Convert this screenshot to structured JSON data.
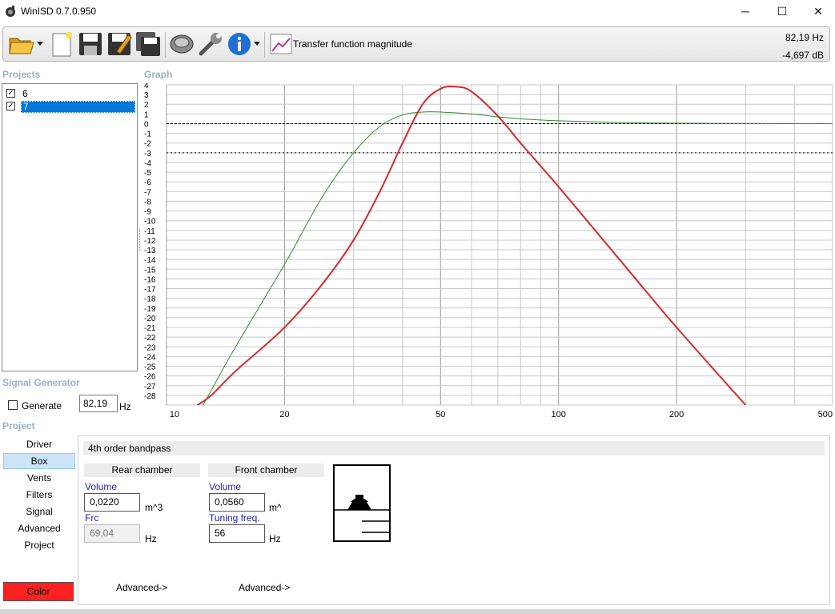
{
  "window": {
    "title": "WinISD 0.7.0.950",
    "controls": {
      "minimize": "─",
      "maximize": "☐",
      "close": "✕"
    }
  },
  "toolbar": {
    "icons": [
      "open-folder-icon",
      "new-file-icon",
      "save-icon",
      "save-as-icon",
      "save-all-icon",
      "driver-icon",
      "tools-icon",
      "info-icon",
      "graph-icon"
    ],
    "graph_type_label": "Transfer function magnitude",
    "readout": {
      "frequency": "82,19 Hz",
      "level": "-4,697 dB"
    }
  },
  "projects": {
    "title": "Projects",
    "items": [
      {
        "label": "6",
        "checked": true,
        "selected": false
      },
      {
        "label": "7",
        "checked": true,
        "selected": true
      }
    ]
  },
  "graph": {
    "title": "Graph"
  },
  "chart_data": {
    "type": "line",
    "title": "",
    "xlabel": "",
    "ylabel": "",
    "x_scale": "log",
    "xlim": [
      10,
      500
    ],
    "ylim": [
      -29,
      4
    ],
    "x_ticks": [
      10,
      20,
      50,
      100,
      200,
      500
    ],
    "y_ticks": [
      4,
      3,
      2,
      1,
      0,
      -1,
      -2,
      -3,
      -4,
      -5,
      -6,
      -7,
      -8,
      -9,
      -10,
      -11,
      -12,
      -13,
      -14,
      -15,
      -16,
      -17,
      -18,
      -19,
      -20,
      -21,
      -22,
      -23,
      -24,
      -25,
      -26,
      -27,
      -28
    ],
    "reference_lines": [
      0,
      -3
    ],
    "grid": true,
    "series": [
      {
        "color": "#2e8b2e",
        "x": [
          12.4,
          13,
          15,
          20,
          25,
          30,
          35,
          40,
          45,
          50,
          60,
          70,
          80,
          100,
          150,
          200,
          300,
          500
        ],
        "y": [
          -29,
          -27.5,
          -23,
          -14.5,
          -7.5,
          -3,
          -0.3,
          0.9,
          1.2,
          1.2,
          1.0,
          0.7,
          0.5,
          0.3,
          0.1,
          0.05,
          0.02,
          0
        ]
      },
      {
        "color": "#d42a2a",
        "x": [
          12,
          13,
          15,
          20,
          25,
          30,
          35,
          40,
          45,
          50,
          55,
          60,
          70,
          80,
          100,
          150,
          200,
          300
        ],
        "y": [
          -29,
          -28,
          -25.5,
          -21,
          -16.5,
          -12,
          -7,
          -2,
          2,
          3.6,
          3.8,
          3.3,
          0.8,
          -2,
          -6.5,
          -15,
          -21,
          -29
        ]
      }
    ]
  },
  "signal_generator": {
    "title": "Signal Generator",
    "generate_label": "Generate",
    "frequency": "82,19",
    "unit": "Hz"
  },
  "project": {
    "title": "Project",
    "nav": [
      "Driver",
      "Box",
      "Vents",
      "Filters",
      "Signal",
      "Advanced",
      "Project"
    ],
    "selected_nav": "Box",
    "color_label": "Color",
    "color": "#ff2020"
  },
  "box": {
    "type": "4th order bandpass",
    "rear": {
      "header": "Rear chamber",
      "volume_label": "Volume",
      "volume": "0,0220",
      "volume_unit": "m^3",
      "frc_label": "Frc",
      "frc": "69,04",
      "frc_unit": "Hz",
      "advanced": "Advanced->"
    },
    "front": {
      "header": "Front chamber",
      "volume_label": "Volume",
      "volume": "0,0560",
      "volume_unit": "m^",
      "tuning_label": "Tuning freq.",
      "tuning": "56",
      "tuning_unit": "Hz",
      "advanced": "Advanced->"
    }
  }
}
